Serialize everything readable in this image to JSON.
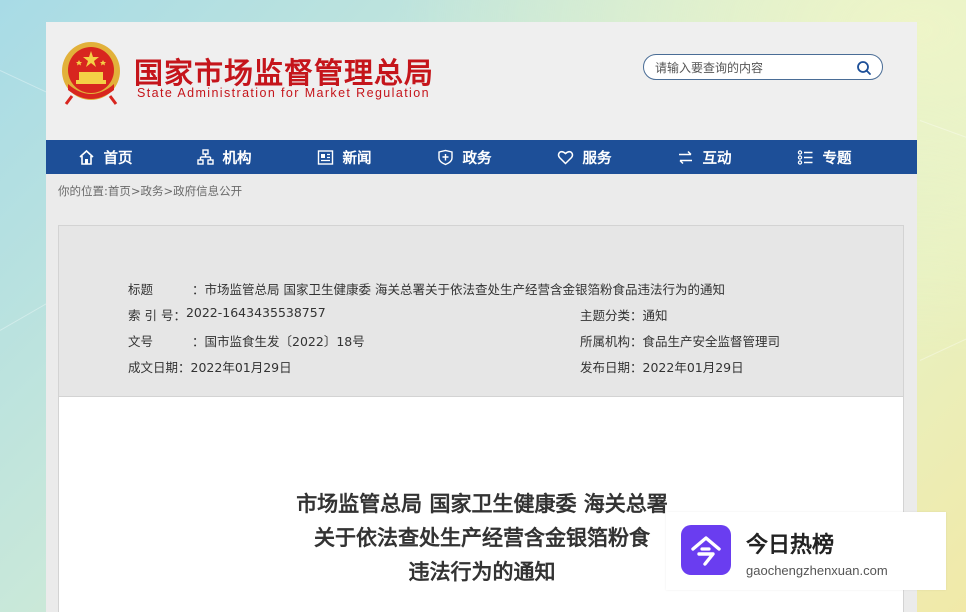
{
  "header": {
    "logo_cn": "国家市场监督管理总局",
    "logo_en": "State Administration for Market Regulation",
    "search_placeholder": "请输入要查询的内容",
    "brand_color": "#c5151b"
  },
  "nav": {
    "color": "#1d4f98",
    "items": [
      {
        "label": "首页",
        "icon": "home-icon"
      },
      {
        "label": "机构",
        "icon": "org-chart-icon"
      },
      {
        "label": "新闻",
        "icon": "newspaper-icon"
      },
      {
        "label": "政务",
        "icon": "shield-icon"
      },
      {
        "label": "服务",
        "icon": "heart-icon"
      },
      {
        "label": "互动",
        "icon": "swap-arrows-icon"
      },
      {
        "label": "专题",
        "icon": "list-icon"
      }
    ]
  },
  "breadcrumb": {
    "prefix": "你的位置:",
    "items": [
      "首页",
      "政务",
      "政府信息公开"
    ],
    "separator": ">"
  },
  "info": {
    "title_label": "标　　题：",
    "title_label_chars": [
      "标",
      "题"
    ],
    "title_value": "市场监管总局 国家卫生健康委 海关总署关于依法查处生产经营含金银箔粉食品违法行为的通知",
    "index_label": "索 引 号：",
    "index_value": "2022-1643435538757",
    "category_label": "主题分类：",
    "category_value": "通知",
    "docno_label_chars": [
      "文",
      "号"
    ],
    "docno_value": "国市监食生发〔2022〕18号",
    "agency_label": "所属机构：",
    "agency_value": "食品生产安全监督管理司",
    "written_label": "成文日期：",
    "written_value": "2022年01月29日",
    "published_label": "发布日期：",
    "published_value": "2022年01月29日"
  },
  "document": {
    "title_lines": [
      "市场监管总局 国家卫生健康委 海关总署",
      "关于依法查处生产经营含金银箔粉食",
      "违法行为的通知"
    ]
  },
  "watermark": {
    "name": "今日热榜",
    "url": "gaochengzhenxuan.com",
    "color": "#6a3df0"
  }
}
